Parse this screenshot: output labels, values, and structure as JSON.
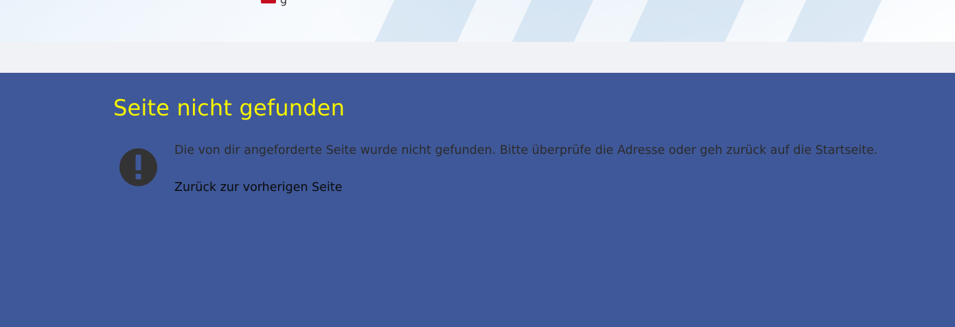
{
  "header": {
    "flag_label": "g"
  },
  "error": {
    "title": "Seite nicht gefunden",
    "icon": "exclamation-circle-icon",
    "message": "Die von dir angeforderte Seite wurde nicht gefunden. Bitte überprüfe die Adresse oder geh zurück auf die Startseite.",
    "back_link": "Zurück zur vorherigen Seite"
  },
  "colors": {
    "content_background": "#3f5899",
    "title": "#f6f400",
    "subbar": "#f1f2f6",
    "flag": "#c40d1e"
  }
}
